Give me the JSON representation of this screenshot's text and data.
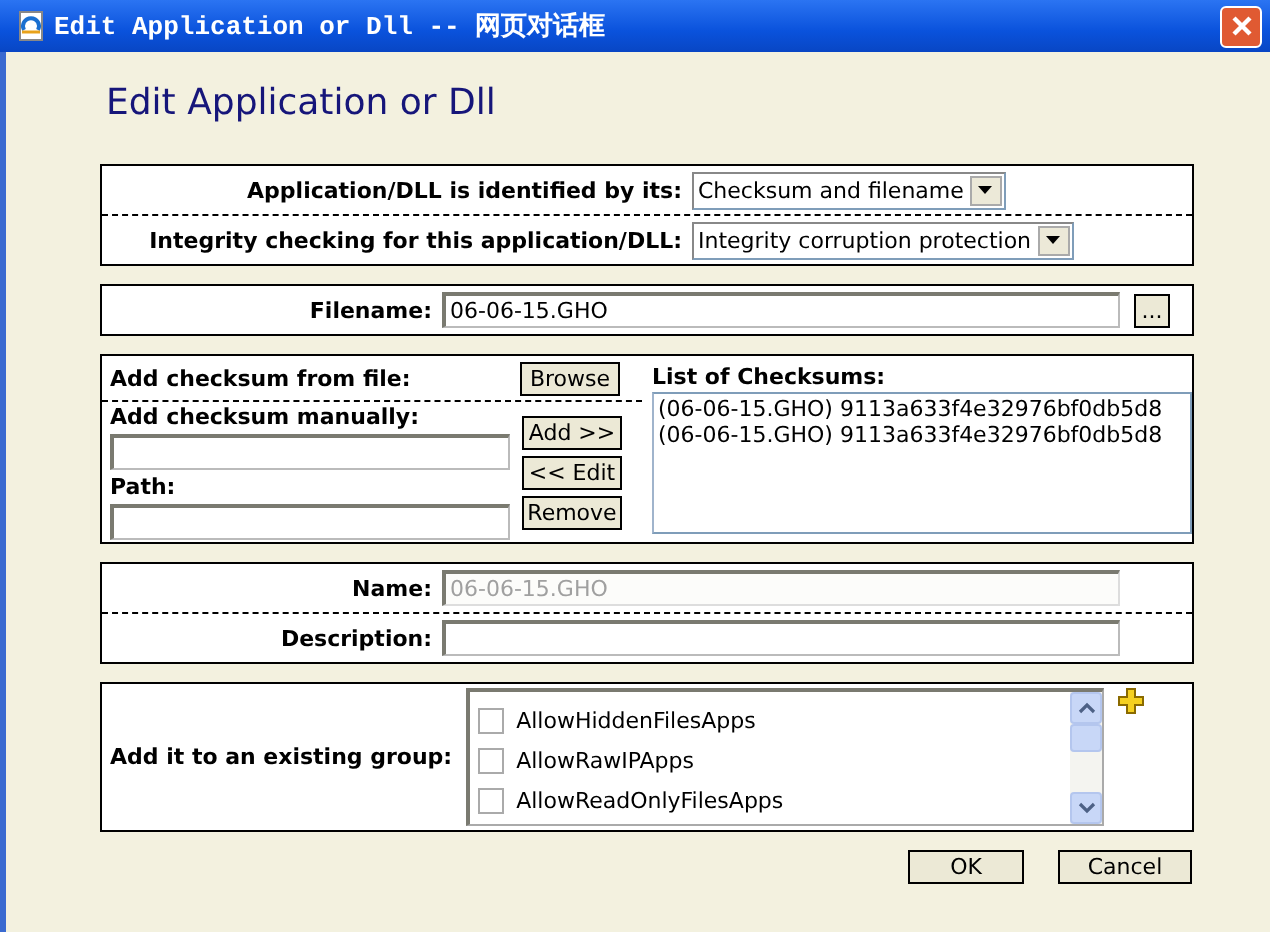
{
  "window": {
    "title": "Edit Application or Dll -- 网页对话框"
  },
  "heading": "Edit Application or Dll",
  "identification": {
    "rows": [
      {
        "label": "Application/DLL is identified by its:",
        "value": "Checksum and filename"
      },
      {
        "label": "Integrity checking for this application/DLL:",
        "value": "Integrity corruption protection"
      }
    ]
  },
  "filename": {
    "label": "Filename:",
    "value": "06-06-15.GHO",
    "browse_button": "..."
  },
  "checksums": {
    "from_file_label": "Add checksum from file:",
    "browse_button": "Browse",
    "manual_label": "Add checksum manually:",
    "path_label": "Path:",
    "buttons": [
      "Add >>",
      "<< Edit",
      "Remove"
    ],
    "list_label": "List of Checksums:",
    "items": [
      {
        "text": "(06-06-15.GHO) 9113a633f4e32976bf0db5d8",
        "selected": false
      },
      {
        "text": "(06-06-15.GHO) 9113a633f4e32976bf0db5d8",
        "selected": false
      }
    ]
  },
  "details": {
    "rows": [
      {
        "label": "Name:",
        "value": "06-06-15.GHO",
        "disabled": true
      },
      {
        "label": "Description:",
        "disabled": false
      }
    ]
  },
  "groups": {
    "label": "Add it to an existing group:",
    "items": [
      {
        "label": "AllowHiddenFilesApps",
        "checked": false
      },
      {
        "label": "AllowRawIPApps",
        "checked": false
      },
      {
        "label": "AllowReadOnlyFilesApps",
        "checked": false
      }
    ]
  },
  "buttons": [
    "OK",
    "Cancel"
  ]
}
